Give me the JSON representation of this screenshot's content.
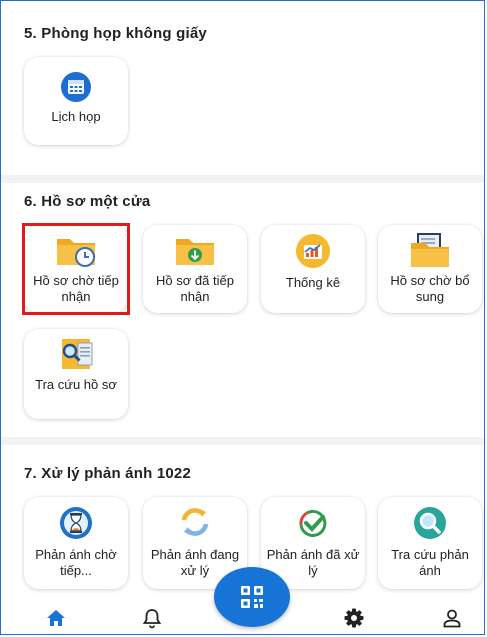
{
  "sections": [
    {
      "title": "5. Phòng họp không giấy",
      "tiles": [
        {
          "label": "Lịch họp",
          "icon": "calendar-icon"
        }
      ]
    },
    {
      "title": "6. Hồ sơ một cửa",
      "tiles": [
        {
          "label": "Hồ sơ chờ tiếp nhận",
          "icon": "folder-clock-icon",
          "selected": true
        },
        {
          "label": "Hồ sơ đã tiếp nhận",
          "icon": "folder-download-icon"
        },
        {
          "label": "Thống kê",
          "icon": "chart-folder-icon"
        },
        {
          "label": "Hồ sơ chờ bổ sung",
          "icon": "folder-documents-icon"
        },
        {
          "label": "Tra cứu hồ sơ",
          "icon": "search-document-icon"
        }
      ]
    },
    {
      "title": "7. Xử lý phản ánh 1022",
      "tiles": [
        {
          "label": "Phản ánh chờ tiếp...",
          "icon": "hourglass-icon"
        },
        {
          "label": "Phản ánh đang xử lý",
          "icon": "refresh-icon"
        },
        {
          "label": "Phản ánh đã xử lý",
          "icon": "check-circle-icon"
        },
        {
          "label": "Tra cứu phản ánh",
          "icon": "search-icon"
        }
      ]
    }
  ],
  "bottom_nav": [
    {
      "name": "home",
      "icon": "home-icon",
      "active": true
    },
    {
      "name": "notifications",
      "icon": "bell-icon"
    },
    {
      "name": "qr-scan",
      "icon": "qr-code-icon"
    },
    {
      "name": "settings",
      "icon": "gear-icon"
    },
    {
      "name": "profile",
      "icon": "user-icon"
    }
  ],
  "colors": {
    "primary": "#1674d6",
    "highlight": "#e01b1b",
    "folder": "#f5b82e"
  }
}
